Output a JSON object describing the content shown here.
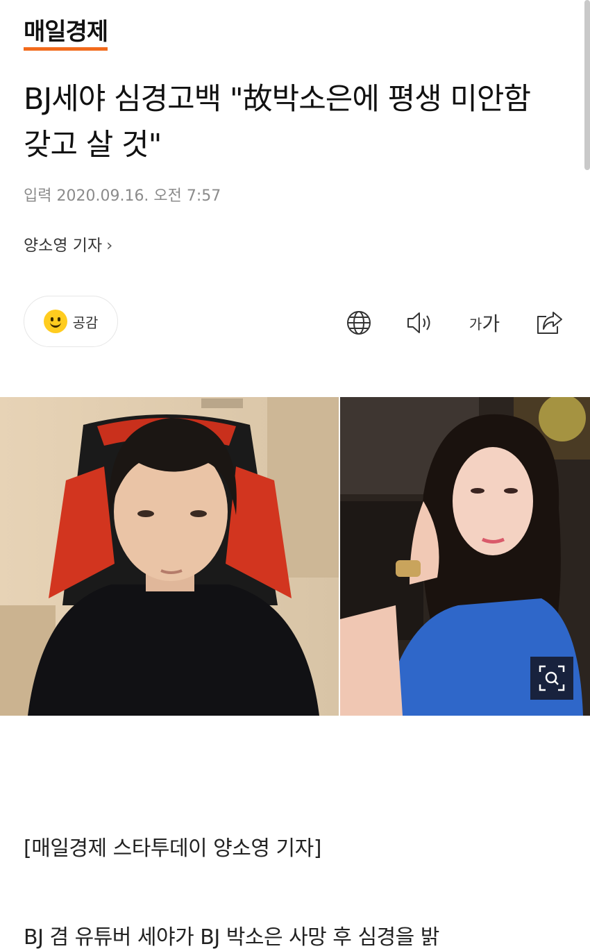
{
  "header": {
    "logo_text": "매일경제",
    "accent_color": "#f26a1b"
  },
  "article": {
    "title": "BJ세야 심경고백 \"故박소은에 평생 미안함 갖고 살 것\"",
    "date": "입력 2020.09.16. 오전 7:57",
    "reporter": "양소영 기자",
    "reporter_chevron": "›",
    "byline": "[매일경제 스타투데이 양소영 기자]",
    "body_first_line": "BJ 겸 유튜버 세야가 BJ 박소은 사망 후 심경을 밝"
  },
  "toolbar": {
    "empathy_label": "공감",
    "font_size_small": "가",
    "font_size_large": "가",
    "icons": [
      "globe-icon",
      "speaker-icon",
      "font-size-icon",
      "share-icon"
    ]
  },
  "photo": {
    "zoom_icon": "zoom-icon"
  }
}
